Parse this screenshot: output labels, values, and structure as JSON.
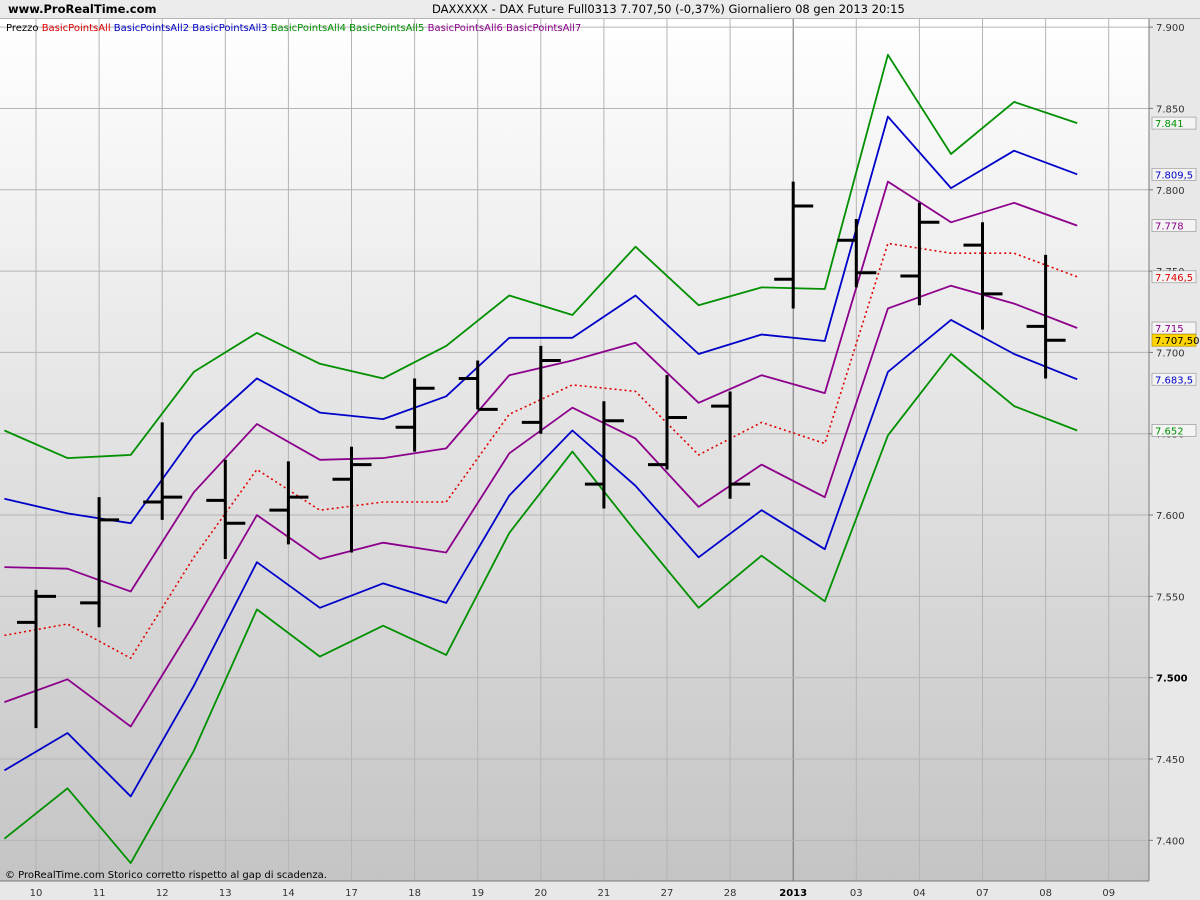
{
  "header": {
    "site": "www.ProRealTime.com",
    "title": "DAXXXXX - DAX Future Full0313    7.707,50 (-0,37%)    Giornaliero  08 gen 2013 20:15"
  },
  "footer": {
    "note": "© ProRealTime.com  Storico corretto rispetto al gap di scadenza."
  },
  "colors": {
    "price": "#000000",
    "BasicPointsAll": "#e00000",
    "BasicPointsAll2": "#0000c8",
    "BasicPointsAll3": "#0000c8",
    "BasicPointsAll4": "#009000",
    "BasicPointsAll5": "#009000",
    "BasicPointsAll6": "#8c008c",
    "BasicPointsAll7": "#8c008c"
  },
  "chart_data": {
    "type": "line",
    "ylim": [
      7375,
      7905
    ],
    "yticks": [
      "7.900",
      "7.850",
      "7.800",
      "7.750",
      "7.700",
      "7.650",
      "7.600",
      "7.550",
      "7.500",
      "7.450",
      "7.400"
    ],
    "yticks_bold": [
      "7.500"
    ],
    "categories": [
      "10",
      "11",
      "12",
      "13",
      "14",
      "17",
      "18",
      "19",
      "20",
      "21",
      "27",
      "28",
      "2013",
      "03",
      "04",
      "07",
      "08",
      "09"
    ],
    "categories_bold": [
      "2013"
    ],
    "legend": [
      "Prezzo",
      "BasicPointsAll",
      "BasicPointsAll2",
      "BasicPointsAll3",
      "BasicPointsAll4",
      "BasicPointsAll5",
      "BasicPointsAll6",
      "BasicPointsAll7"
    ],
    "price_bars": [
      {
        "open": 7534,
        "high": 7554,
        "low": 7469,
        "close": 7550
      },
      {
        "open": 7546,
        "high": 7611,
        "low": 7531,
        "close": 7597
      },
      {
        "open": 7608,
        "high": 7657,
        "low": 7597,
        "close": 7611
      },
      {
        "open": 7609,
        "high": 7634,
        "low": 7573,
        "close": 7595
      },
      {
        "open": 7603,
        "high": 7633,
        "low": 7582,
        "close": 7611
      },
      {
        "open": 7622,
        "high": 7642,
        "low": 7577,
        "close": 7631
      },
      {
        "open": 7654,
        "high": 7684,
        "low": 7639,
        "close": 7678
      },
      {
        "open": 7684,
        "high": 7695,
        "low": 7665,
        "close": 7665
      },
      {
        "open": 7657,
        "high": 7704,
        "low": 7650,
        "close": 7695
      },
      {
        "open": 7619,
        "high": 7670,
        "low": 7604,
        "close": 7658
      },
      {
        "open": 7631,
        "high": 7686,
        "low": 7628,
        "close": 7660
      },
      {
        "open": 7667,
        "high": 7676,
        "low": 7610,
        "close": 7619
      },
      {
        "open": 7745,
        "high": 7805,
        "low": 7727,
        "close": 7790
      },
      {
        "open": 7769,
        "high": 7782,
        "low": 7740,
        "close": 7749
      },
      {
        "open": 7747,
        "high": 7792,
        "low": 7729,
        "close": 7780
      },
      {
        "open": 7766,
        "high": 7780,
        "low": 7714,
        "close": 7736
      },
      {
        "open": 7716,
        "high": 7760,
        "low": 7684,
        "close": 7707.5
      }
    ],
    "series": [
      {
        "name": "BasicPointsAll4",
        "color": "#009000",
        "dashed": false,
        "x_start": -0.5,
        "values": [
          7652,
          7635,
          7637,
          7688,
          7712,
          7693,
          7684,
          7704,
          7735,
          7723,
          7765,
          7729,
          7740,
          7739,
          7883,
          7822,
          7854,
          7841
        ]
      },
      {
        "name": "BasicPointsAll2",
        "color": "#0000c8",
        "dashed": false,
        "x_start": -0.5,
        "values": [
          7610,
          7601,
          7595,
          7649,
          7684,
          7663,
          7659,
          7673,
          7709,
          7709,
          7735,
          7699,
          7711,
          7707,
          7845,
          7801,
          7824,
          7809.5
        ]
      },
      {
        "name": "BasicPointsAll6",
        "color": "#8c008c",
        "dashed": false,
        "x_start": -0.5,
        "values": [
          7568,
          7567,
          7553,
          7614,
          7656,
          7634,
          7635,
          7641,
          7686,
          7695,
          7706,
          7669,
          7686,
          7675,
          7805,
          7780,
          7792,
          7778
        ]
      },
      {
        "name": "BasicPointsAll",
        "color": "#e00000",
        "dashed": true,
        "x_start": -0.5,
        "values": [
          7526,
          7533,
          7512,
          7574,
          7628,
          7603,
          7608,
          7608,
          7662,
          7680,
          7676,
          7637,
          7657,
          7644,
          7767,
          7761,
          7761,
          7746.5
        ]
      },
      {
        "name": "BasicPointsAll7",
        "color": "#8c008c",
        "dashed": false,
        "x_start": -0.5,
        "values": [
          7485,
          7499,
          7470,
          7533,
          7600,
          7573,
          7583,
          7577,
          7638,
          7666,
          7647,
          7605,
          7631,
          7611,
          7727,
          7741,
          7730,
          7715
        ]
      },
      {
        "name": "BasicPointsAll3",
        "color": "#0000c8",
        "dashed": false,
        "x_start": -0.5,
        "values": [
          7443,
          7466,
          7427,
          7495,
          7571,
          7543,
          7558,
          7546,
          7612,
          7652,
          7618,
          7574,
          7603,
          7579,
          7688,
          7720,
          7699,
          7683.5
        ]
      },
      {
        "name": "BasicPointsAll5",
        "color": "#009000",
        "dashed": false,
        "x_start": -0.5,
        "values": [
          7401,
          7432,
          7386,
          7455,
          7542,
          7513,
          7532,
          7514,
          7589,
          7639,
          7590,
          7543,
          7575,
          7547,
          7649,
          7699,
          7667,
          7652
        ]
      }
    ],
    "right_labels": [
      {
        "text": "7.841",
        "value": 7841,
        "color": "#009000",
        "bg": "#f4f4f4"
      },
      {
        "text": "7.809,5",
        "value": 7809.5,
        "color": "#0000c8",
        "bg": "#f4f4f4"
      },
      {
        "text": "7.778",
        "value": 7778,
        "color": "#8c008c",
        "bg": "#f4f4f4"
      },
      {
        "text": "7.746,5",
        "value": 7746.5,
        "color": "#e00000",
        "bg": "#f4f4f4"
      },
      {
        "text": "7.715",
        "value": 7715,
        "color": "#8c008c",
        "bg": "#f4f4f4"
      },
      {
        "text": "7.707,50",
        "value": 7707.5,
        "color": "#000000",
        "bg": "#ffd400"
      },
      {
        "text": "7.683,5",
        "value": 7683.5,
        "color": "#0000c8",
        "bg": "#f4f4f4"
      },
      {
        "text": "7.652",
        "value": 7652,
        "color": "#009000",
        "bg": "#f4f4f4"
      }
    ],
    "separator_at_category": "2013",
    "grid": true
  }
}
